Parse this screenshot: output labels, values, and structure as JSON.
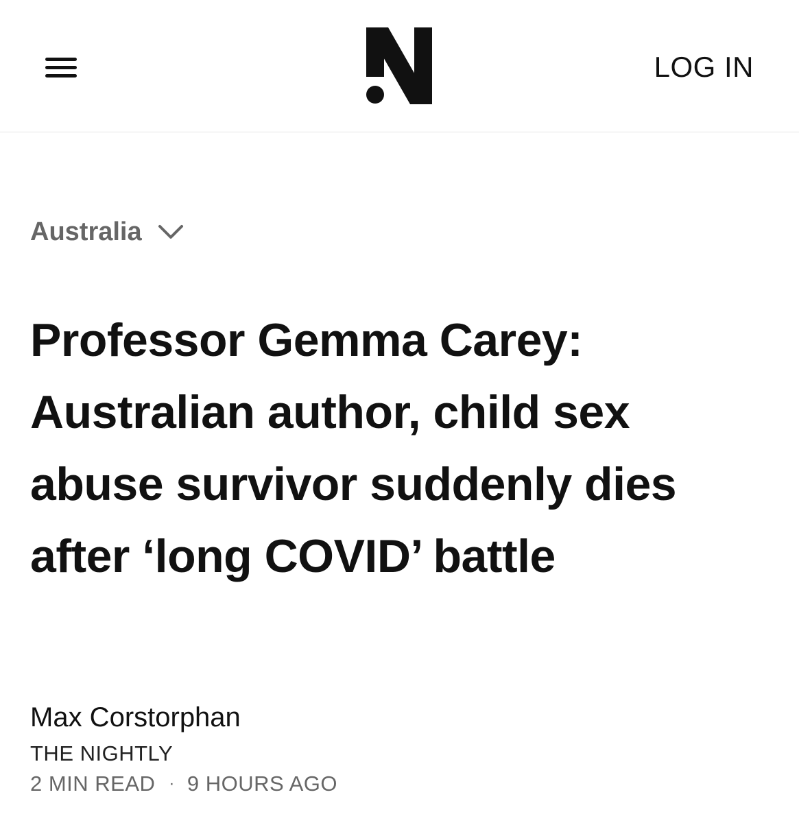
{
  "header": {
    "menu_icon": "hamburger-menu-icon",
    "logo_icon": "the-nightly-n-logo-icon",
    "login_label": "LOG IN"
  },
  "article": {
    "section": "Australia",
    "section_icon": "chevron-down-icon",
    "headline": "Professor Gemma Carey: Australian author, child sex abuse survivor suddenly dies after ‘long COVID’ battle",
    "author": "Max Corstorphan",
    "publication": "THE NIGHTLY",
    "read_time": "2 MIN READ",
    "separator": "·",
    "published": "9 HOURS AGO"
  },
  "colors": {
    "text_primary": "#111111",
    "text_muted": "#666666",
    "divider": "#e6e6e6",
    "background": "#ffffff"
  }
}
